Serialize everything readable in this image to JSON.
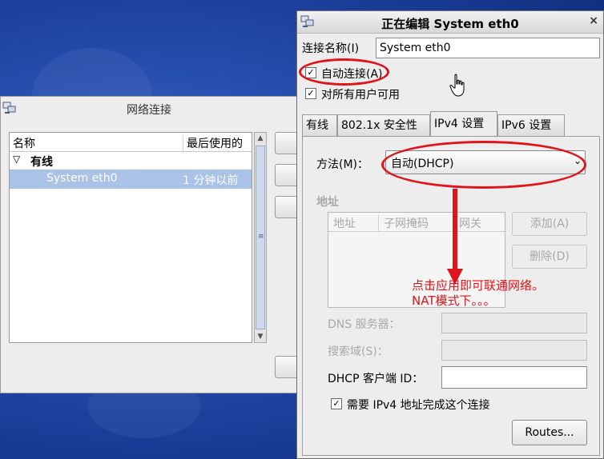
{
  "background_window": {
    "title": "网络连接",
    "columns": [
      "名称",
      "最后使用的"
    ],
    "group_label": "有线",
    "connection": {
      "name": "System eth0",
      "last_used": "1 分钟以前"
    }
  },
  "editor": {
    "title": "正在编辑 System eth0",
    "close_glyph": "×",
    "name_label": "连接名称(I)",
    "name_value": "System eth0",
    "auto_connect_label": "自动连接(A)",
    "auto_connect_checked": true,
    "all_users_label": "对所有用户可用",
    "all_users_checked": true,
    "tabs": [
      "有线",
      "802.1x 安全性",
      "IPv4 设置",
      "IPv6 设置"
    ],
    "active_tab": "IPv4 设置",
    "method_label": "方法(M)：",
    "method_value": "自动(DHCP)",
    "address_section_label": "地址",
    "address_columns": [
      "地址",
      "子网掩码",
      "网关"
    ],
    "add_button": "添加(A)",
    "delete_button": "删除(D)",
    "dns_label": "DNS 服务器：",
    "search_domain_label": "搜索域(S)：",
    "dhcp_client_label": "DHCP 客户端 ID：",
    "dhcp_client_value": "",
    "require_ipv4_label": "需要 IPv4 地址完成这个连接",
    "require_ipv4_checked": true,
    "routes_button": "Routes..."
  },
  "annotation": {
    "line1": "点击应用即可联通网络。",
    "line2": "NAT模式下。。。",
    "color": "#e0151b"
  },
  "colors": {
    "desktop": "#2850b0",
    "selection": "#a9c2e6",
    "window_bg": "#ededed"
  }
}
